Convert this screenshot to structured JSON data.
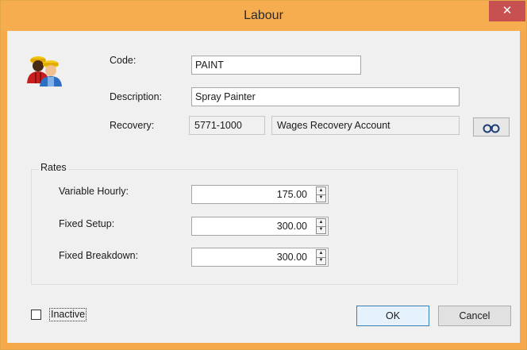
{
  "window": {
    "title": "Labour",
    "close_glyph": "✕"
  },
  "form": {
    "code_label": "Code:",
    "code_value": "PAINT",
    "description_label": "Description:",
    "description_value": "Spray Painter",
    "recovery_label": "Recovery:",
    "recovery_code": "5771-1000",
    "recovery_name": "Wages Recovery Account",
    "lookup_icon": "binoculars-icon"
  },
  "rates": {
    "group_label": "Rates",
    "variable_hourly_label": "Variable Hourly:",
    "variable_hourly_value": "175.00",
    "fixed_setup_label": "Fixed Setup:",
    "fixed_setup_value": "300.00",
    "fixed_breakdown_label": "Fixed Breakdown:",
    "fixed_breakdown_value": "300.00"
  },
  "footer": {
    "inactive_label": "Inactive",
    "inactive_checked": false,
    "ok_label": "OK",
    "cancel_label": "Cancel"
  },
  "colors": {
    "titlebar": "#f6ad50",
    "close_button": "#c75050",
    "client_background": "#f0f0f0"
  }
}
